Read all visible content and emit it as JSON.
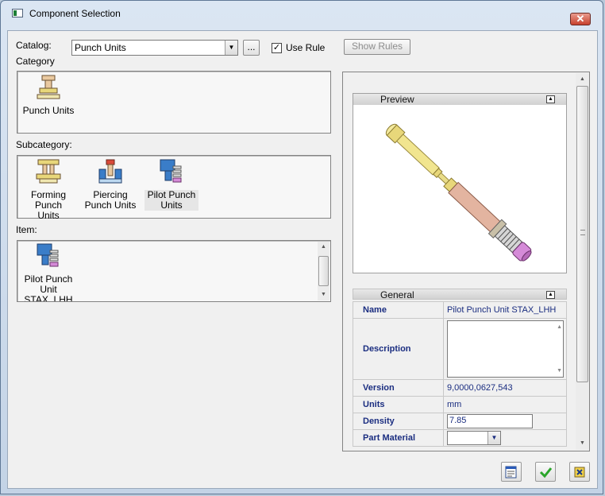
{
  "window": {
    "title": "Component Selection",
    "close_label": "✕"
  },
  "catalog": {
    "label": "Catalog:",
    "value": "Punch Units",
    "browse_label": "...",
    "use_rule_label": "Use Rule",
    "use_rule_checked": true,
    "show_rules_label": "Show Rules"
  },
  "category": {
    "label": "Category",
    "items": [
      {
        "label": "Punch Units",
        "icon": "punch-units-icon"
      }
    ]
  },
  "subcategory": {
    "label": "Subcategory:",
    "items": [
      {
        "label_line1": "Forming Punch",
        "label_line2": "Units",
        "icon": "forming-punch-icon"
      },
      {
        "label_line1": "Piercing",
        "label_line2": "Punch Units",
        "icon": "piercing-punch-icon"
      },
      {
        "label_line1": "Pilot Punch",
        "label_line2": "Units",
        "icon": "pilot-punch-icon",
        "selected": true
      }
    ]
  },
  "item": {
    "label": "Item:",
    "items": [
      {
        "label_line1": "Pilot Punch",
        "label_line2": "Unit",
        "label_line3": "STAX_LHH",
        "icon": "pilot-punch-unit-icon"
      }
    ]
  },
  "preview": {
    "header": "Preview"
  },
  "general": {
    "header": "General",
    "name_label": "Name",
    "name_value": "Pilot Punch Unit STAX_LHH",
    "description_label": "Description",
    "description_value": "",
    "version_label": "Version",
    "version_value": "9,0000,0627,543",
    "units_label": "Units",
    "units_value": "mm",
    "density_label": "Density",
    "density_value": "7.85",
    "part_material_label": "Part Material",
    "part_material_value": ""
  },
  "buttons": {
    "properties": "properties-icon",
    "ok": "check-icon",
    "cancel": "cancel-icon"
  },
  "colors": {
    "pin_yellow": "#e8d77a",
    "pin_pink": "#d4a38a",
    "spring": "#9a9a9a",
    "cap_purple": "#d58bd8",
    "ok_green": "#2aa52a"
  }
}
